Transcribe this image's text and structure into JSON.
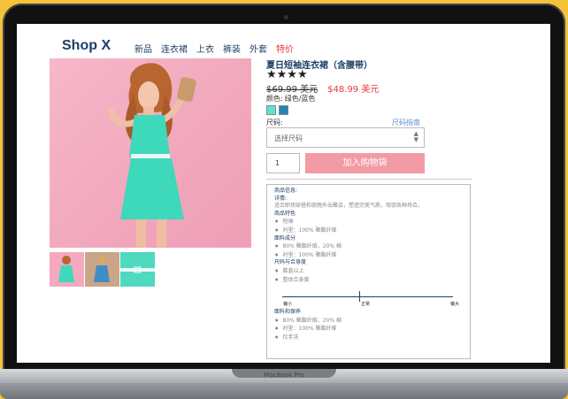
{
  "device": {
    "brand": "MacBook Pro"
  },
  "header": {
    "logo": "Shop X",
    "nav": [
      "新品",
      "连衣裙",
      "上衣",
      "裤装",
      "外套",
      "特价"
    ]
  },
  "product": {
    "title": "夏日短袖连衣裙（含腰带）",
    "stars": "★★★★",
    "old_price": "$69.99 美元",
    "new_price": "$48.99 美元",
    "color_label": "颜色:",
    "color_value": "绿色/蓝色",
    "swatch_colors": [
      "#5fe3d0",
      "#1e86b8"
    ],
    "size_label": "尺码:",
    "size_guide": "尺码指南",
    "size_placeholder": "选择尺码",
    "quantity": "1",
    "add_to_cart": "加入购物袋"
  },
  "info": {
    "section_title": "商品信息:",
    "details_label": "详情:",
    "details_text": "适合职场穿搭和夜晚外出聚会，塑造完美气质，驾驭各种场合。",
    "features_title": "商品特色",
    "features": [
      "短袖",
      "衬里：100% 聚酯纤维"
    ],
    "fabric_title": "面料成分",
    "fabric": [
      "80% 聚酯纤维，20% 棉",
      "衬里：100% 聚酯纤维"
    ],
    "fit_title": "尺码与合身度",
    "fit": [
      "膝盖以上",
      "整体合身度"
    ],
    "fit_scale": {
      "small": "偏小",
      "normal": "正常",
      "large": "偏大"
    },
    "care_title": "面料和保养",
    "care": [
      "80% 聚酯纤维，20% 棉",
      "衬里：100% 聚酯纤维",
      "仅手洗"
    ]
  },
  "colors": {
    "brand": "#1c3f66",
    "sale": "#e43b3b",
    "cart_button": "#f29ba5",
    "link": "#5b8fd0"
  }
}
